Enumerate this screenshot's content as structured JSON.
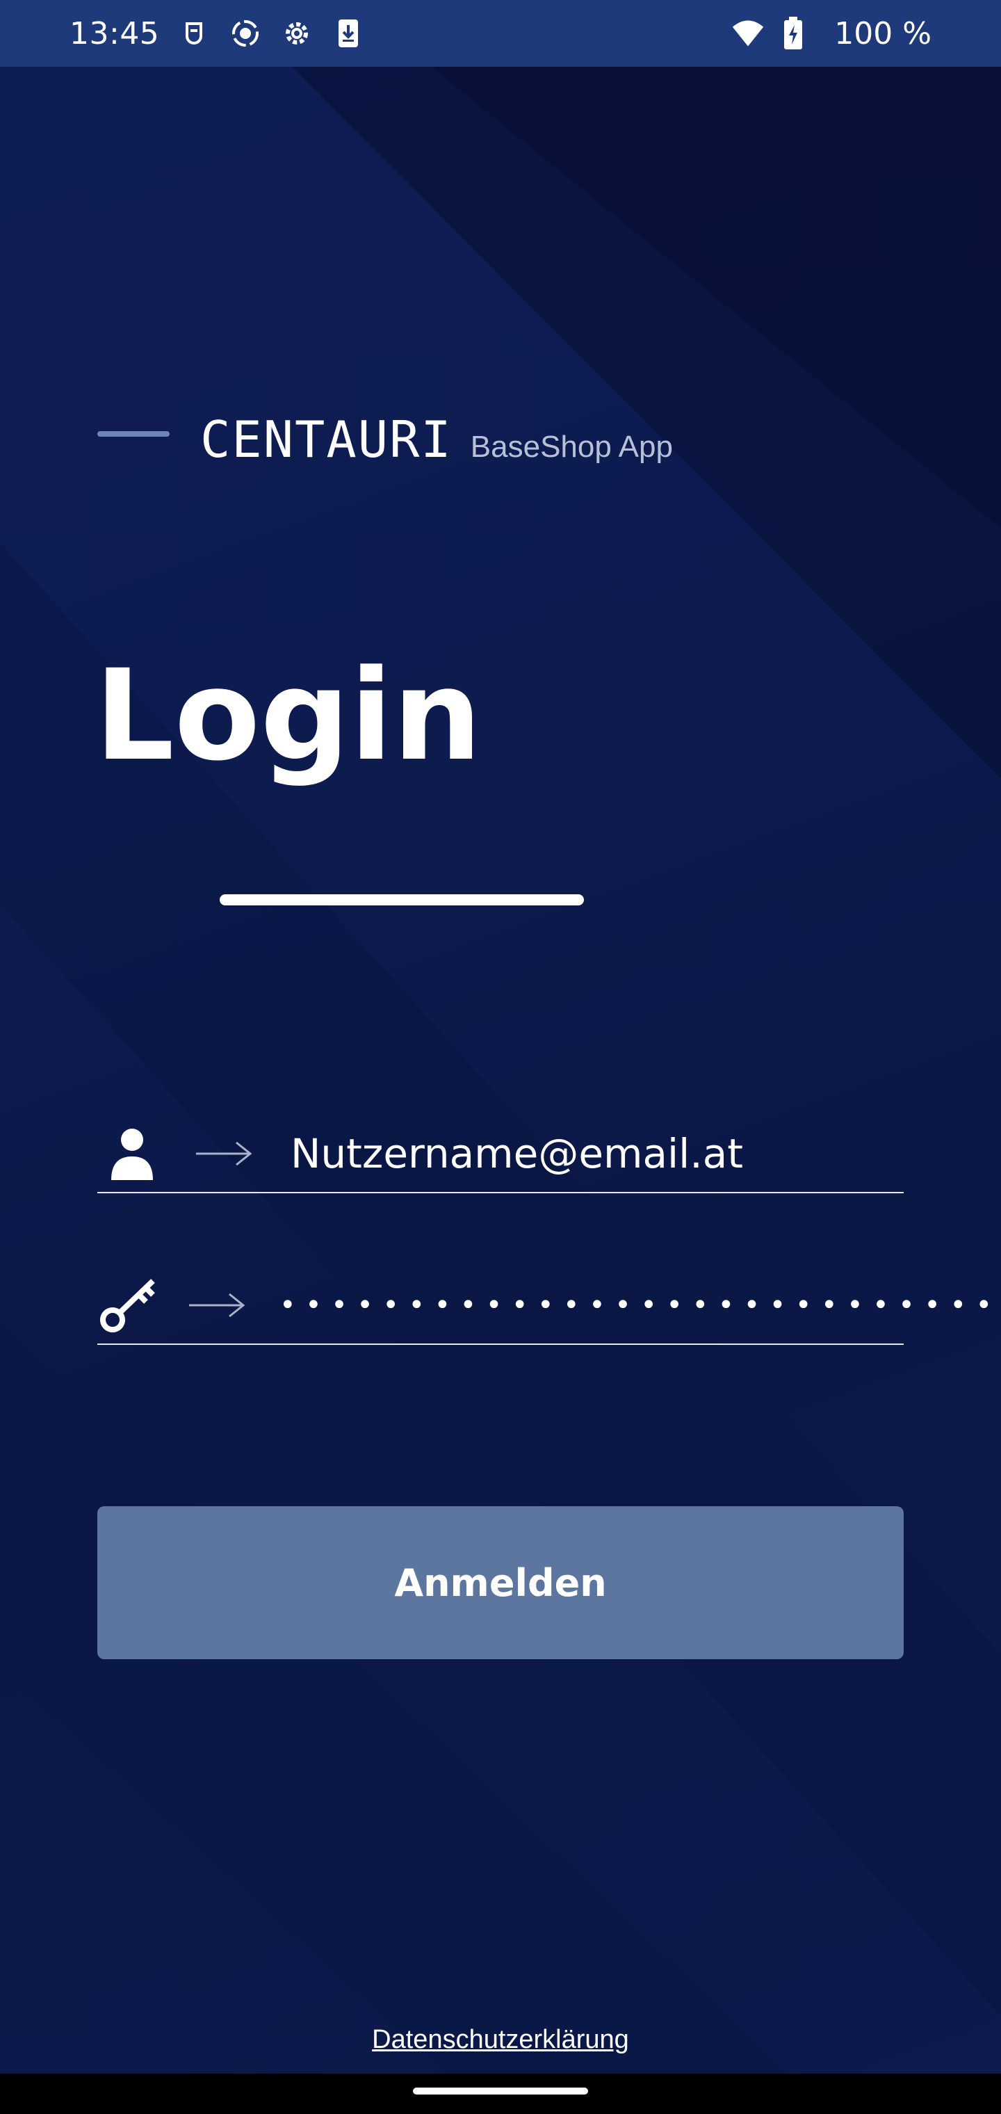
{
  "status_bar": {
    "time": "13:45",
    "battery_text": "100 %",
    "left_icons": [
      "vpn-shield-icon",
      "screen-record-icon",
      "settings-gear-icon",
      "download-icon"
    ],
    "right_icons": [
      "wifi-icon",
      "battery-charging-icon"
    ]
  },
  "brand": {
    "name": "CENTAURI",
    "subtitle": "BaseShop App"
  },
  "login": {
    "title": "Login",
    "username_value": "Nutzername@email.at",
    "password_mask": "••••••••••••••••••••••••••••••",
    "username_icon": "user-icon",
    "password_icon": "key-icon",
    "arrow_icon": "arrow-right-icon",
    "submit_label": "Anmelden",
    "privacy_link": "Datenschutzerklärung"
  },
  "colors": {
    "background": "#0c1a4d",
    "status_bar": "#1e3a7a",
    "button": "#5d769f",
    "accent_dash": "#6c84b8",
    "subtitle_text": "#b7c0d6"
  }
}
